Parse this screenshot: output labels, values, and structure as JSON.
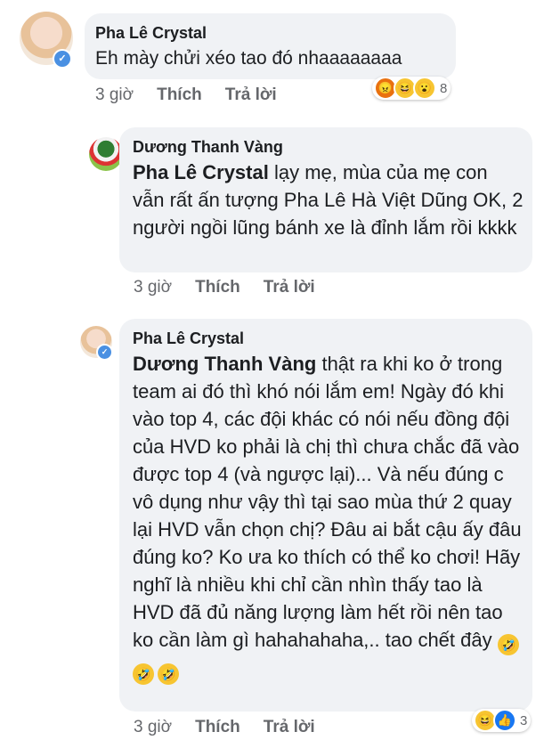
{
  "comments": [
    {
      "author": "Pha Lê Crystal",
      "text": "Eh mày chửi xéo tao đó nhaaaaaaaa",
      "time": "3 giờ",
      "like_label": "Thích",
      "reply_label": "Trả lời",
      "reaction_count": "8",
      "reactions": [
        "angry-reaction",
        "haha-reaction",
        "wow-reaction"
      ]
    },
    {
      "author": "Dương Thanh Vàng",
      "mention": "Pha Lê Crystal",
      "text": " lạy mẹ, mùa của mẹ con vẫn rất ấn tượng Pha Lê Hà Việt Dũng OK, 2 người ngồi lũng bánh xe là đỉnh lắm rồi kkkk",
      "time": "3 giờ",
      "like_label": "Thích",
      "reply_label": "Trả lời"
    },
    {
      "author": "Pha Lê Crystal",
      "mention": "Dương Thanh Vàng",
      "text": "  thật ra khi ko ở trong team ai đó thì khó nói lắm em! Ngày đó khi vào top 4, các đội khác có nói nếu đồng đội của HVD ko phải là chị thì chưa chắc đã vào được top 4 (và ngược lại)... Và nếu đúng c vô dụng như vậy thì tại sao mùa thứ 2 quay lại HVD vẫn chọn chị? Đâu ai bắt cậu ấy đâu đúng ko? Ko ưa ko thích có thể ko chơi! Hãy nghĩ là nhiều khi chỉ cần nhìn thấy tao là HVD đã đủ năng lượng làm hết rồi nên tao ko cần làm gì hahahahaha,.. tao chết đây",
      "time": "3 giờ",
      "like_label": "Thích",
      "reply_label": "Trả lời",
      "reaction_count": "3",
      "reactions": [
        "haha-reaction",
        "like-reaction"
      ]
    }
  ],
  "colors": {
    "bubble": "#f0f2f5",
    "meta_text": "#65676b",
    "verified_badge": "#4a90e2"
  }
}
